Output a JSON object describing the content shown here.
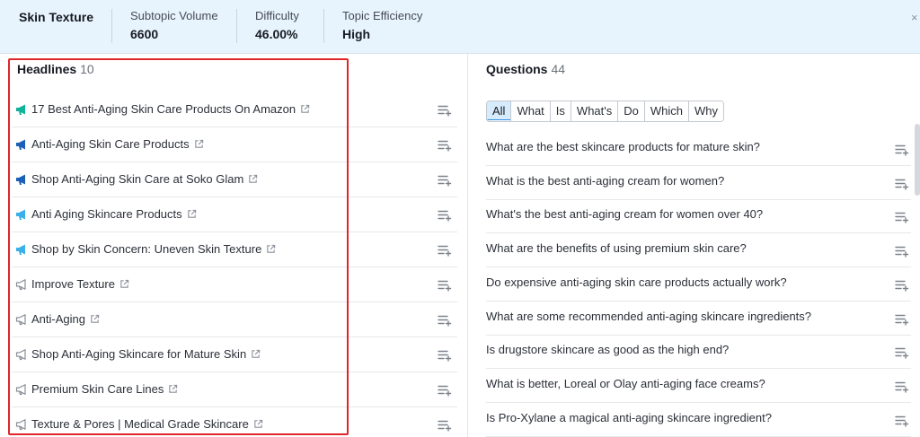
{
  "header": {
    "title": "Skin Texture",
    "metrics": [
      {
        "label": "Subtopic Volume",
        "value": "6600"
      },
      {
        "label": "Difficulty",
        "value": "46.00%"
      },
      {
        "label": "Topic Efficiency",
        "value": "High"
      }
    ],
    "close_glyph": "×"
  },
  "headlines": {
    "title": "Headlines",
    "count": "10",
    "items": [
      {
        "text": "17 Best Anti-Aging Skin Care Products On Amazon",
        "icon": "megaphone-icon",
        "color": "#0fb39a"
      },
      {
        "text": "Anti-Aging Skin Care Products",
        "icon": "megaphone-icon",
        "color": "#1b5fb8"
      },
      {
        "text": "Shop Anti-Aging Skin Care at Soko Glam",
        "icon": "megaphone-icon",
        "color": "#1b5fb8"
      },
      {
        "text": "Anti Aging Skincare Products",
        "icon": "megaphone-icon",
        "color": "#39b0e8"
      },
      {
        "text": "Shop by Skin Concern: Uneven Skin Texture",
        "icon": "megaphone-icon",
        "color": "#39b0e8"
      },
      {
        "text": "Improve Texture",
        "icon": "megaphone-outline-icon",
        "color": "#8a8f98"
      },
      {
        "text": "Anti-Aging",
        "icon": "megaphone-outline-icon",
        "color": "#8a8f98"
      },
      {
        "text": "Shop Anti-Aging Skincare for Mature Skin",
        "icon": "megaphone-outline-icon",
        "color": "#8a8f98"
      },
      {
        "text": "Premium Skin Care Lines",
        "icon": "megaphone-outline-icon",
        "color": "#8a8f98"
      },
      {
        "text": "Texture & Pores | Medical Grade Skincare",
        "icon": "megaphone-outline-icon",
        "color": "#8a8f98"
      }
    ]
  },
  "questions": {
    "title": "Questions",
    "count": "44",
    "filters": [
      "All",
      "What",
      "Is",
      "What's",
      "Do",
      "Which",
      "Why"
    ],
    "active_filter": "All",
    "items": [
      "What are the best skincare products for mature skin?",
      "What is the best anti-aging cream for women?",
      "What's the best anti-aging cream for women over 40?",
      "What are the benefits of using premium skin care?",
      "Do expensive anti-aging skin care products actually work?",
      "What are some recommended anti-aging skincare ingredients?",
      "Is drugstore skincare as good as the high end?",
      "What is better, Loreal or Olay anti-aging face creams?",
      "Is Pro-Xylane a magical anti-aging skincare ingredient?"
    ]
  },
  "colors": {
    "accent": "#2e8fe6",
    "highlight_box": "#e0262b",
    "header_bg": "#e8f4fd"
  }
}
